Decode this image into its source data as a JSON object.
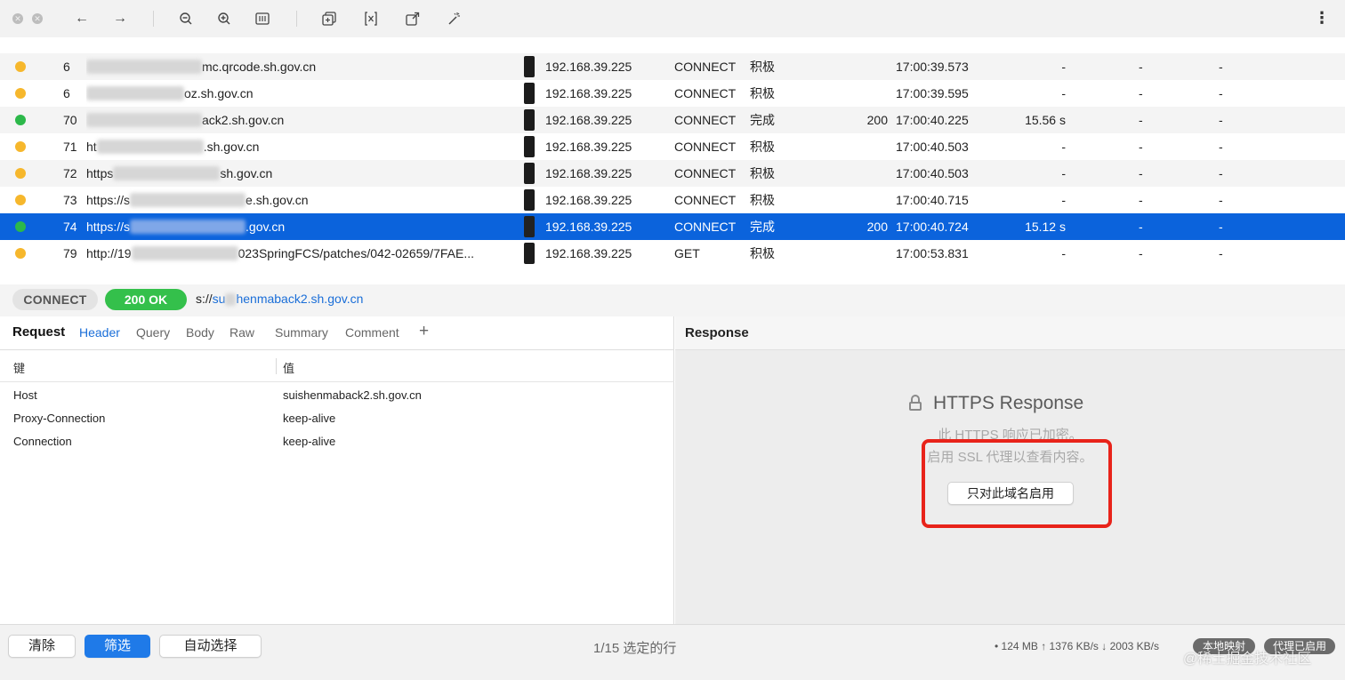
{
  "requests": [
    {
      "id": "6",
      "url": "mc.qrcode.sh.gov.cn",
      "client": "192.168.39.225",
      "method": "CONNECT",
      "state": "积极",
      "code": "",
      "time": "17:00:39.573",
      "duration": "-",
      "req": "-",
      "resp": "-",
      "status_color": "#f6b72c"
    },
    {
      "id": "6",
      "url": "oz.sh.gov.cn",
      "client": "192.168.39.225",
      "method": "CONNECT",
      "state": "积极",
      "code": "",
      "time": "17:00:39.595",
      "duration": "-",
      "req": "-",
      "resp": "-",
      "status_color": "#f6b72c"
    },
    {
      "id": "70",
      "url": "ack2.sh.gov.cn",
      "client": "192.168.39.225",
      "method": "CONNECT",
      "state": "完成",
      "code": "200",
      "time": "17:00:40.225",
      "duration": "15.56 s",
      "req": "-",
      "resp": "-",
      "status_color": "#2cb84a"
    },
    {
      "id": "71",
      "url": "ht",
      "url_tail": ".sh.gov.cn",
      "client": "192.168.39.225",
      "method": "CONNECT",
      "state": "积极",
      "code": "",
      "time": "17:00:40.503",
      "duration": "-",
      "req": "-",
      "resp": "-",
      "status_color": "#f6b72c"
    },
    {
      "id": "72",
      "url": "https",
      "url_tail": "sh.gov.cn",
      "client": "192.168.39.225",
      "method": "CONNECT",
      "state": "积极",
      "code": "",
      "time": "17:00:40.503",
      "duration": "-",
      "req": "-",
      "resp": "-",
      "status_color": "#f6b72c"
    },
    {
      "id": "73",
      "url": "https://s",
      "url_tail": "e.sh.gov.cn",
      "client": "192.168.39.225",
      "method": "CONNECT",
      "state": "积极",
      "code": "",
      "time": "17:00:40.715",
      "duration": "-",
      "req": "-",
      "resp": "-",
      "status_color": "#f6b72c"
    },
    {
      "id": "74",
      "url": "https://s",
      "url_tail": ".gov.cn",
      "client": "192.168.39.225",
      "method": "CONNECT",
      "state": "完成",
      "code": "200",
      "time": "17:00:40.724",
      "duration": "15.12 s",
      "req": "-",
      "resp": "-",
      "status_color": "#2cb84a"
    },
    {
      "id": "79",
      "url": "http://19",
      "url_tail": "023SpringFCS/patches/042-02659/7FAE...",
      "client": "192.168.39.225",
      "method": "GET",
      "state": "积极",
      "code": "",
      "time": "17:00:53.831",
      "duration": "-",
      "req": "-",
      "resp": "-",
      "status_color": "#f6b72c"
    }
  ],
  "detail": {
    "method": "CONNECT",
    "status": "200 OK",
    "url_prefix": "s://",
    "url": "su",
    "url_rest": "henmaback2.sh.gov.cn"
  },
  "request_pane": {
    "title": "Request",
    "tabs": [
      "Header",
      "Query",
      "Body",
      "Raw",
      "Summary",
      "Comment"
    ],
    "add": "+",
    "key_header": "键",
    "value_header": "值",
    "headers": [
      {
        "key": "Host",
        "value": "suishenmaback2.sh.gov.cn"
      },
      {
        "key": "Proxy-Connection",
        "value": "keep-alive"
      },
      {
        "key": "Connection",
        "value": "keep-alive"
      }
    ]
  },
  "response_pane": {
    "title": "Response",
    "https_title": "HTTPS Response",
    "line1": "此 HTTPS 响应已加密。",
    "line2": "启用 SSL 代理以查看内容。",
    "enable_button": "只对此域名启用"
  },
  "bottom": {
    "clear": "清除",
    "filter": "筛选",
    "auto_select": "自动选择",
    "selection": "1/15 选定的行",
    "stats": "• 124 MB ↑ 1376 KB/s ↓ 2003 KB/s",
    "chip_local": "本地映射",
    "chip_proxy": "代理已启用",
    "watermark": "@稀土掘金技术社区"
  },
  "colors": {
    "accent": "#0b63dc",
    "link": "#1a6ed8",
    "success": "#34c04b",
    "pending": "#f6b72c",
    "highlight": "#e8231a"
  },
  "icons": {
    "close": "close-icon",
    "minimize": "minimize-icon",
    "back": "arrow-left-icon",
    "forward": "arrow-right-icon",
    "zoom_out": "zoom-out-icon",
    "zoom_in": "zoom-in-icon",
    "layout": "layout-icon",
    "compose": "compose-icon",
    "script": "script-icon",
    "open": "open-external-icon",
    "magic": "magic-wand-icon",
    "more": "more-icon",
    "lock": "lock-icon"
  }
}
